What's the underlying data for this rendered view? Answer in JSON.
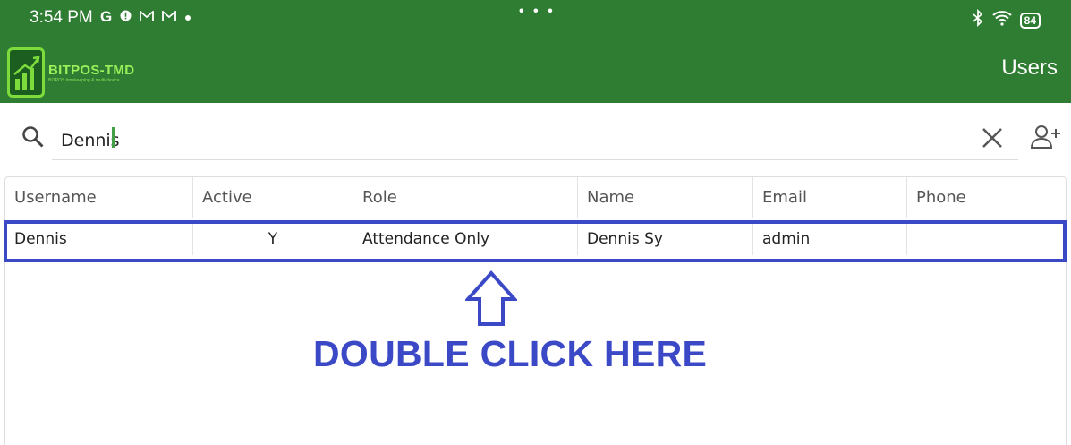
{
  "status_bar": {
    "time": "3:54 PM",
    "left_icons": [
      "google-icon",
      "alert-icon",
      "gmail-icon",
      "gmail-icon",
      "dot-icon"
    ],
    "center_dots": "• • •",
    "battery": "84"
  },
  "app_bar": {
    "logo_name": "BITPOS-TMD",
    "logo_tagline": "BITPOS timekeeping & multi-device",
    "title": "Users"
  },
  "search": {
    "value": "Dennis",
    "placeholder": ""
  },
  "table": {
    "columns": [
      "Username",
      "Active",
      "Role",
      "Name",
      "Email",
      "Phone"
    ],
    "rows": [
      {
        "username": "Dennis",
        "active": "Y",
        "role": "Attendance Only",
        "name": "Dennis Sy",
        "email": "admin",
        "phone": ""
      }
    ]
  },
  "annotation": {
    "text": "DOUBLE CLICK HERE",
    "color": "#3b49c7"
  },
  "colors": {
    "app_bar": "#2e7d32",
    "accent": "#43a047",
    "annotation": "#3b49c7"
  }
}
